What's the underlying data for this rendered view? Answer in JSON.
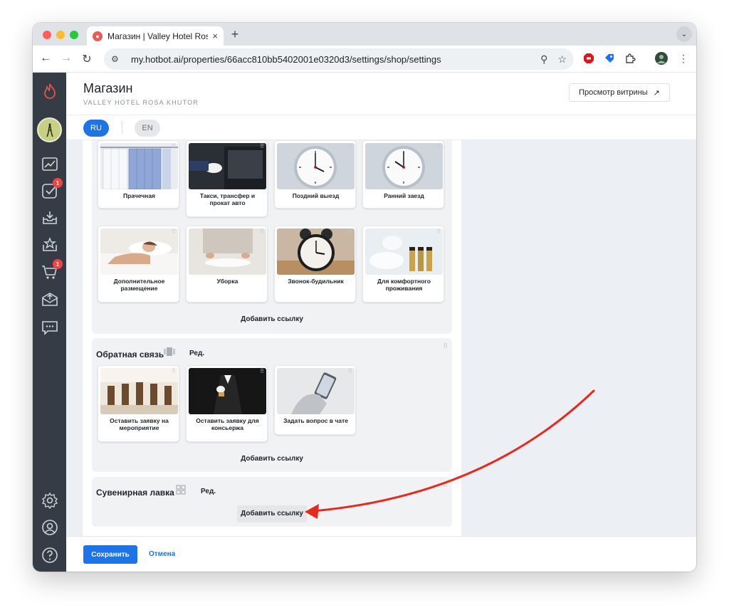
{
  "browser": {
    "tab_title": "Магазин | Valley Hotel Rosa Khutor",
    "url": "my.hotbot.ai/properties/66acc810bb5402001e0320d3/settings/shop/settings",
    "new_tab": "+",
    "tab_menu_icon": "chevron-down-icon"
  },
  "sidebar": {
    "badges": {
      "tasks": "1",
      "cart": "1"
    }
  },
  "header": {
    "title": "Магазин",
    "subtitle": "VALLEY HOTEL ROSA KHUTOR",
    "preview_button": "Просмотр витрины",
    "preview_icon": "↗"
  },
  "languages": {
    "ru": "RU",
    "en": "EN"
  },
  "services": {
    "cards": [
      {
        "label": "Прачечная"
      },
      {
        "label": "Такси, трансфер и прокат авто"
      },
      {
        "label": "Поздний выезд"
      },
      {
        "label": "Ранний заезд"
      },
      {
        "label": "Дополнительное размещение"
      },
      {
        "label": "Уборка"
      },
      {
        "label": "Звонок-будильник"
      },
      {
        "label": "Для комфортного проживания"
      }
    ],
    "add_link": "Добавить ссылку"
  },
  "feedback": {
    "title": "Обратная связь",
    "edit": "Ред.",
    "cards": [
      {
        "label": "Оставить заявку на мероприятие"
      },
      {
        "label": "Оставить заявку для консьержа"
      },
      {
        "label": "Задать вопрос в чате"
      }
    ],
    "add_link": "Добавить ссылку"
  },
  "souvenir": {
    "title": "Сувенирная лавка",
    "edit": "Ред.",
    "add_link": "Добавить ссылку"
  },
  "footer": {
    "save": "Сохранить",
    "cancel": "Отмена"
  },
  "colors": {
    "accent": "#1e73e8",
    "sidebar": "#363c45",
    "badge": "#ef4444",
    "annotation_arrow": "#e8291c"
  }
}
